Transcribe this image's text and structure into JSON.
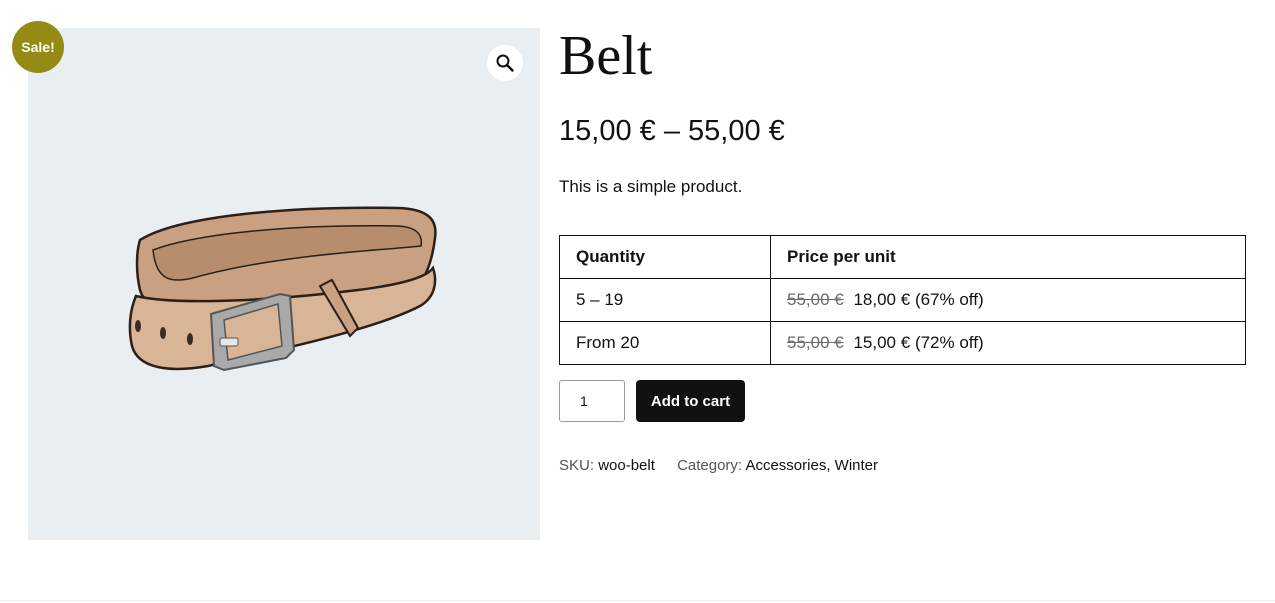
{
  "badge": {
    "sale_label": "Sale!"
  },
  "product": {
    "title": "Belt",
    "price_range": "15,00 € – 55,00 €",
    "description": "This is a simple product."
  },
  "tier_table": {
    "headers": [
      "Quantity",
      "Price per unit"
    ],
    "rows": [
      {
        "quantity": "5 – 19",
        "regular": "55,00 €",
        "sale": "18,00 €",
        "discount": "(67% off)"
      },
      {
        "quantity": "From 20",
        "regular": "55,00 €",
        "sale": "15,00 €",
        "discount": "(72% off)"
      }
    ]
  },
  "cart": {
    "quantity_value": "1",
    "add_to_cart_label": "Add to cart"
  },
  "meta": {
    "sku_label": "SKU:",
    "sku_value": "woo-belt",
    "category_label": "Category:",
    "categories": [
      "Accessories",
      "Winter"
    ],
    "category_separator": ", "
  },
  "icons": {
    "zoom": "magnifier-icon"
  },
  "colors": {
    "badge_bg": "#958b14",
    "gallery_bg": "#e9eef3",
    "button_bg": "#111111"
  }
}
